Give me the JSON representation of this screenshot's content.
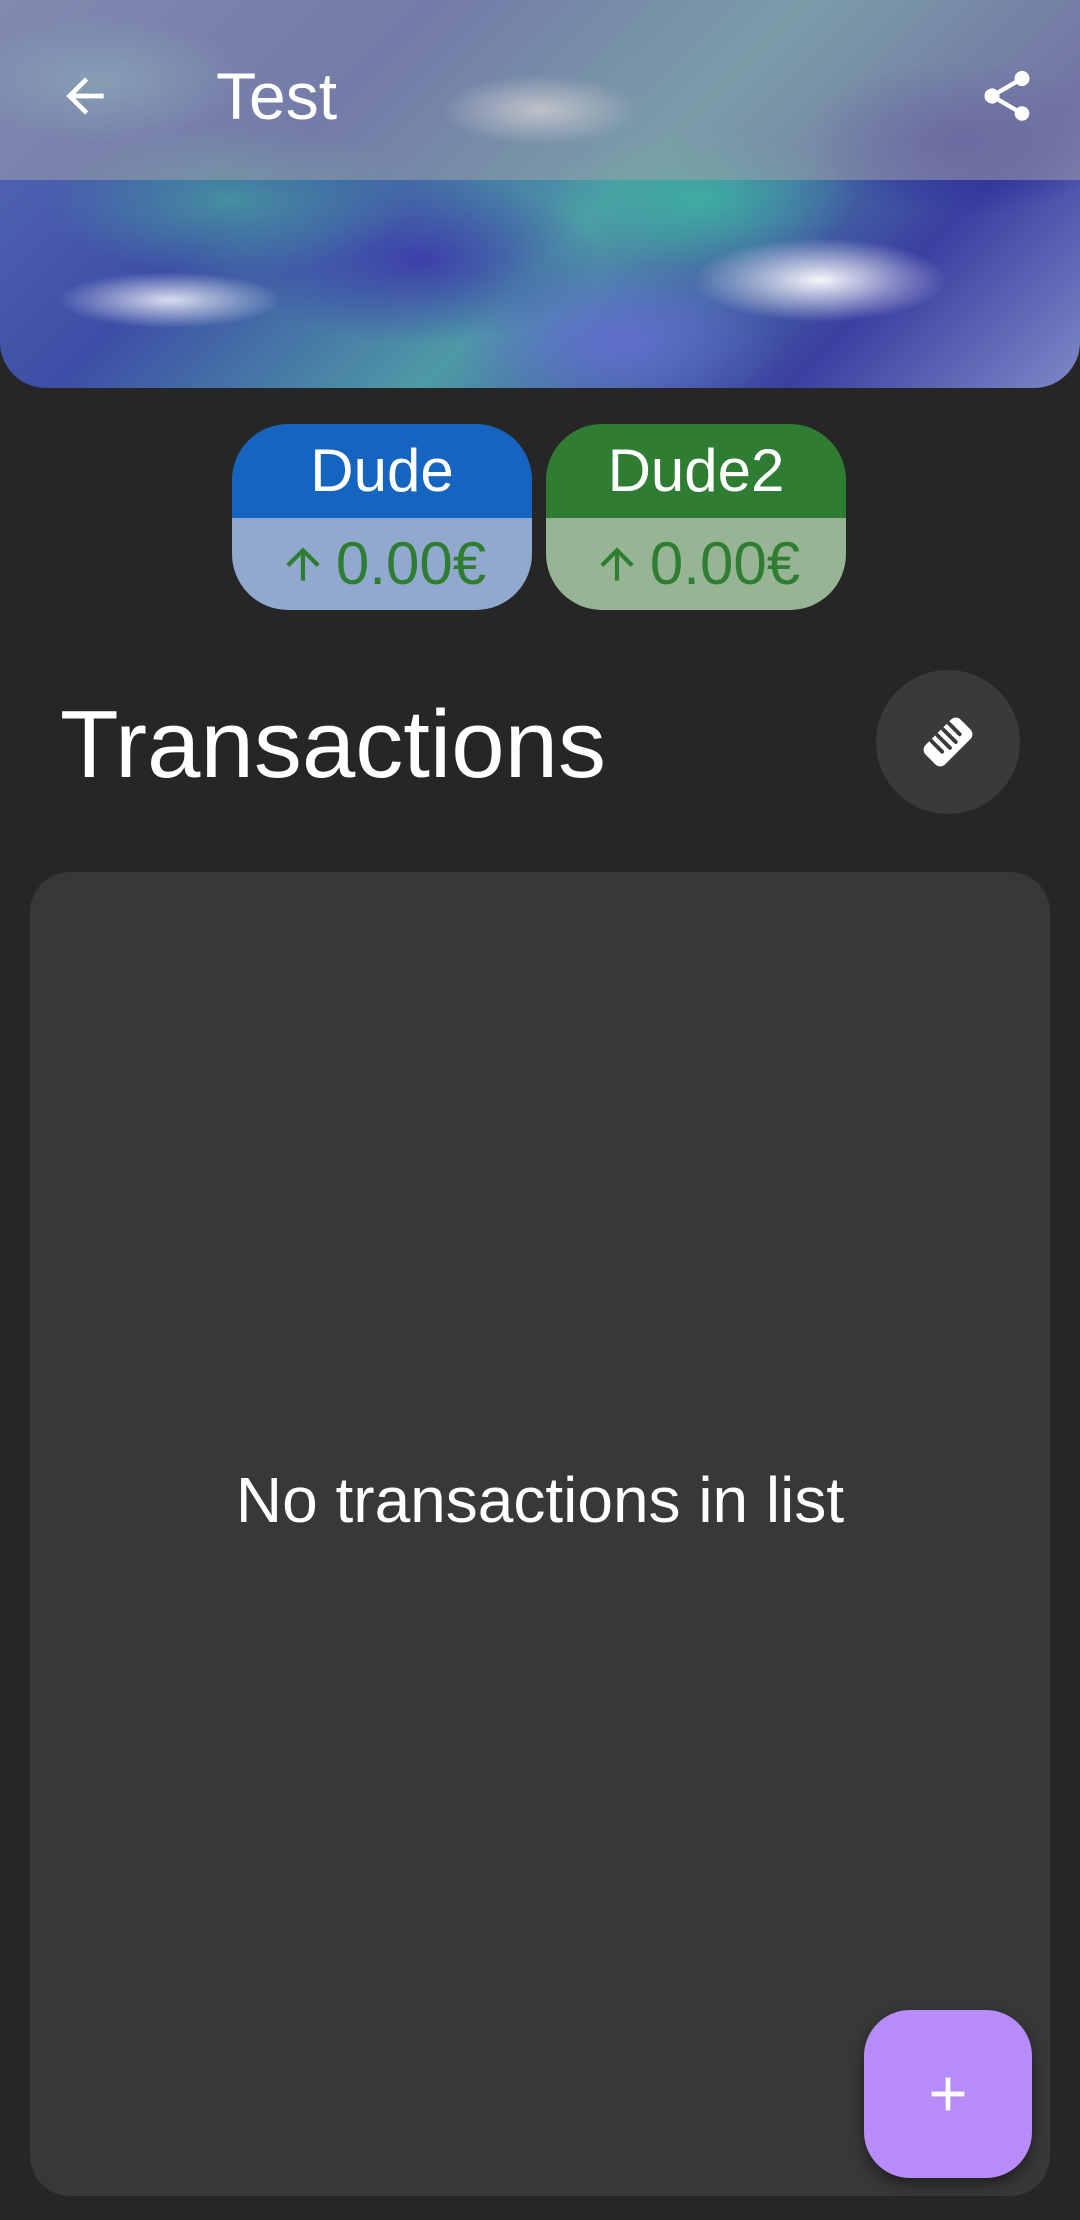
{
  "header": {
    "title": "Test",
    "back_icon": "arrow-back-icon",
    "share_icon": "share-icon"
  },
  "members": [
    {
      "name": "Dude",
      "balance": "0.00€",
      "direction_icon": "arrow-up-icon",
      "header_color": "#1565c0",
      "balance_bg": "#92a9cf"
    },
    {
      "name": "Dude2",
      "balance": "0.00€",
      "direction_icon": "arrow-up-icon",
      "header_color": "#2e7d32",
      "balance_bg": "#97b494"
    }
  ],
  "transactions": {
    "heading": "Transactions",
    "settle_icon": "handshake-icon",
    "empty_message": "No transactions in list"
  },
  "fab": {
    "icon": "plus-icon"
  },
  "colors": {
    "background": "#262626",
    "panel": "#383838",
    "fab": "#b88cf8",
    "balance_text": "#2e7d32"
  }
}
